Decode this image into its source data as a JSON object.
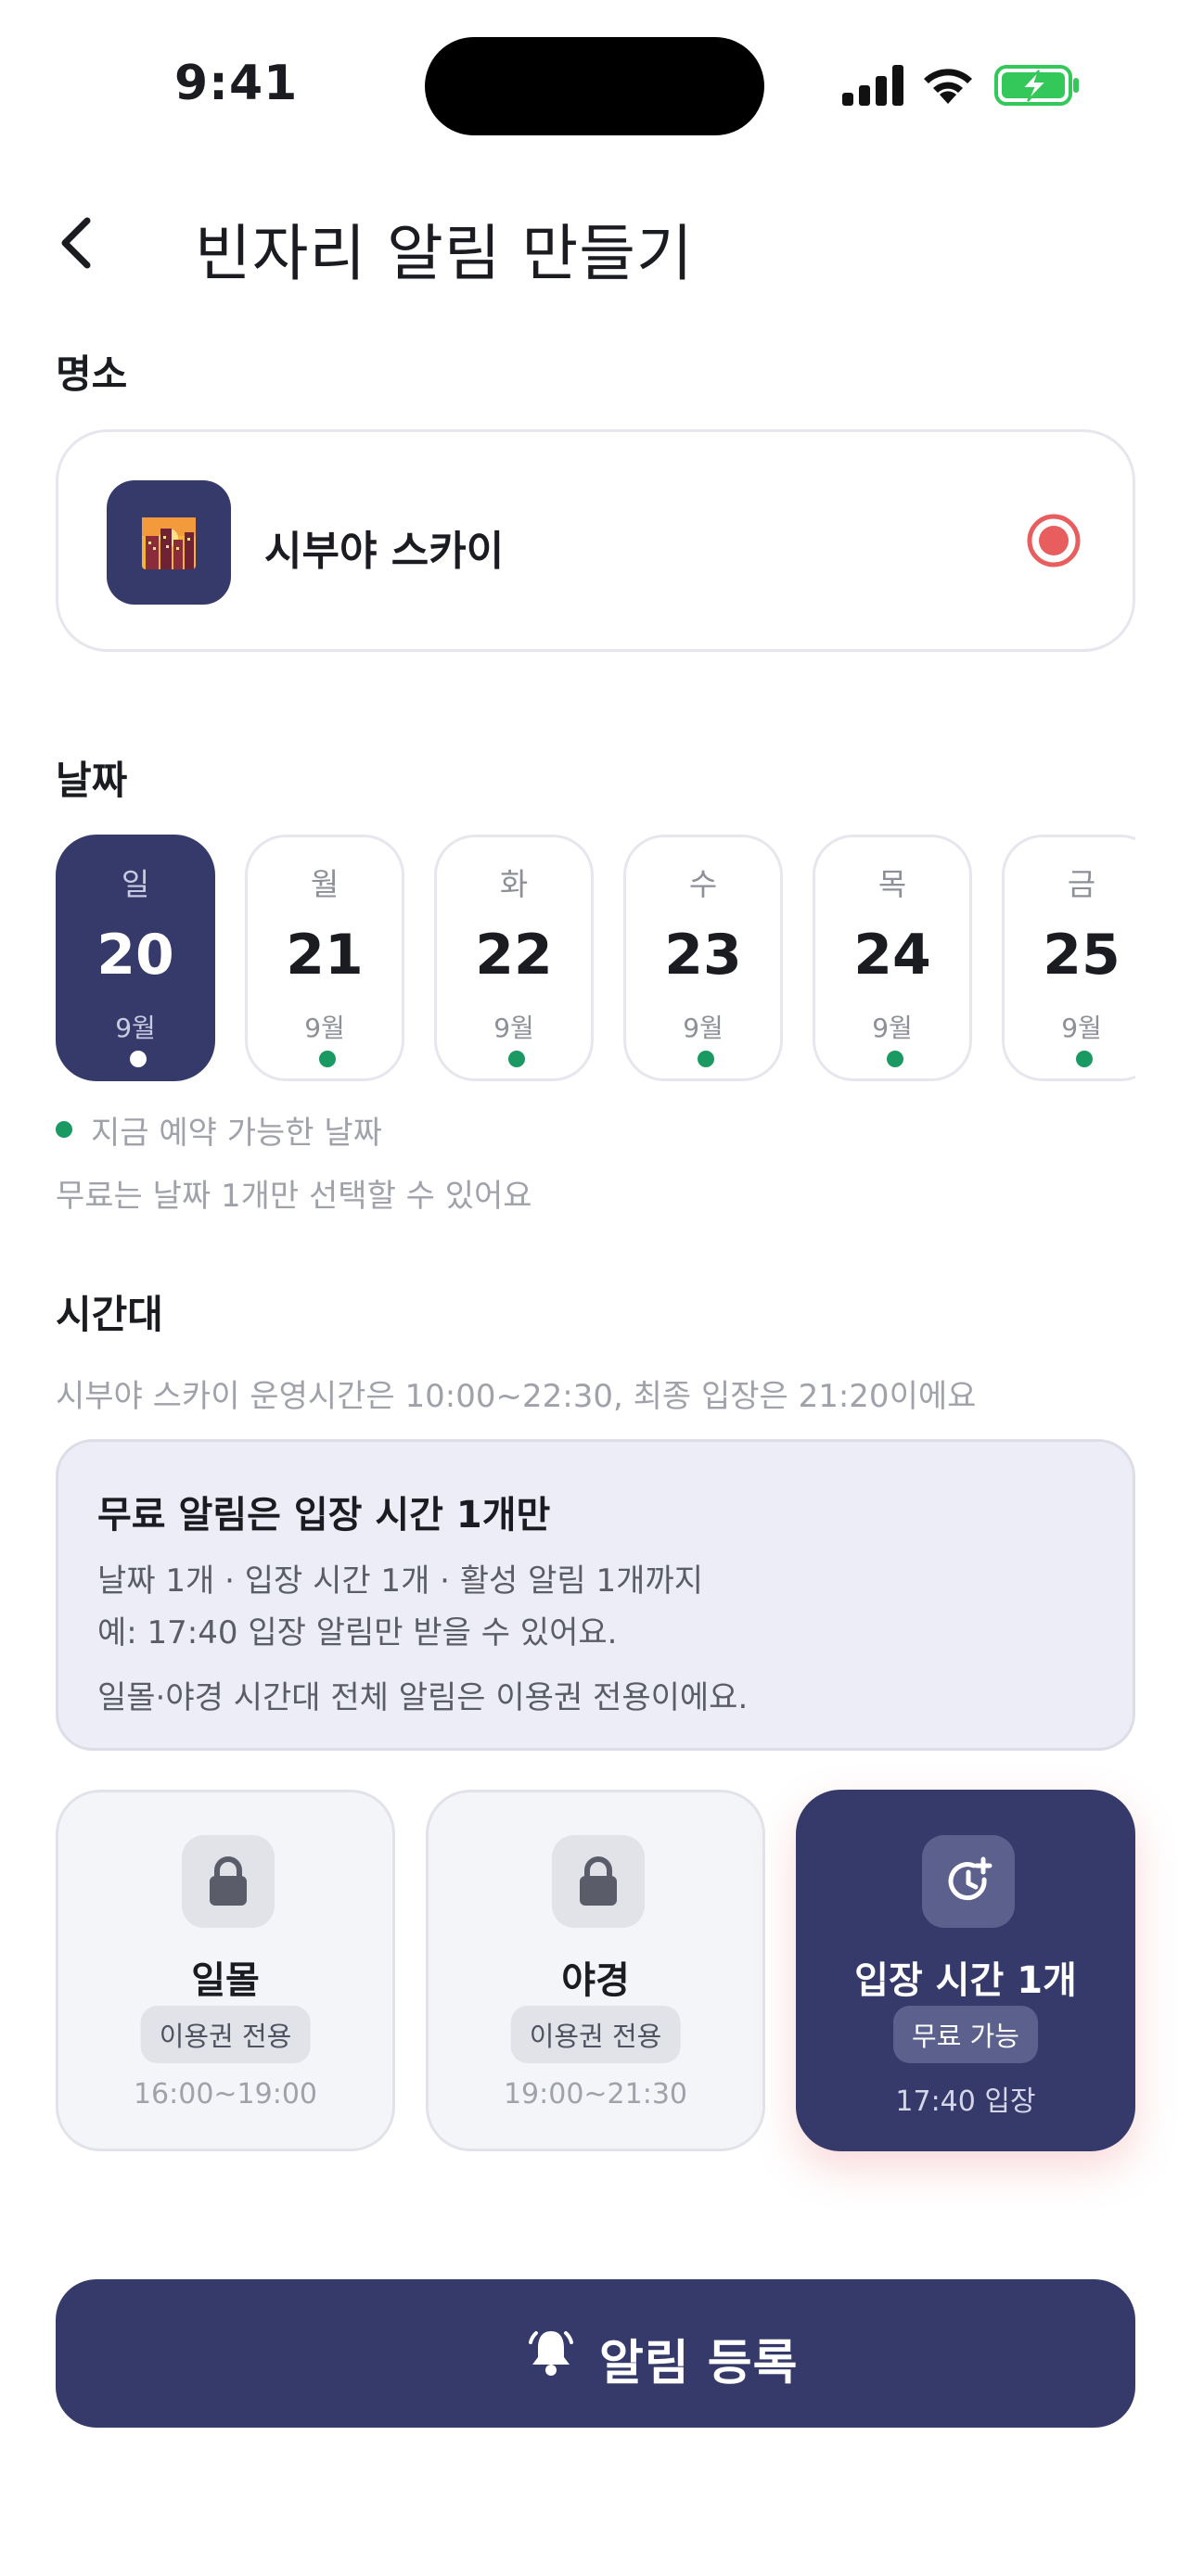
{
  "status_bar": {
    "time": "9:41"
  },
  "header": {
    "title": "빈자리 알림 만들기"
  },
  "sections": {
    "place": "명소",
    "date": "날짜",
    "time": "시간대"
  },
  "place": {
    "name": "시부야 스카이",
    "thumb_icon": "city-sunset-icon",
    "selected": true
  },
  "dates": [
    {
      "dow": "일",
      "day": "20",
      "month": "9월",
      "selected": true
    },
    {
      "dow": "월",
      "day": "21",
      "month": "9월",
      "selected": false
    },
    {
      "dow": "화",
      "day": "22",
      "month": "9월",
      "selected": false
    },
    {
      "dow": "수",
      "day": "23",
      "month": "9월",
      "selected": false
    },
    {
      "dow": "목",
      "day": "24",
      "month": "9월",
      "selected": false
    },
    {
      "dow": "금",
      "day": "25",
      "month": "9월",
      "selected": false
    }
  ],
  "date_legend": "지금 예약 가능한 날짜",
  "date_note": "무료는 날짜 1개만 선택할 수 있어요",
  "time_note": "시부야 스카이 운영시간은 10:00~22:30, 최종 입장은 21:20이에요",
  "info_box": {
    "title": "무료 알림은 입장 시간 1개만",
    "line1": "날짜 1개 · 입장 시간 1개 · 활성 알림 1개까지",
    "line2": "예: 17:40 입장 알림만 받을 수 있어요.",
    "line3": "일몰·야경 시간대 전체 알림은 이용권 전용이에요."
  },
  "slots": [
    {
      "name": "일몰",
      "badge": "이용권 전용",
      "range": "16:00~19:00",
      "icon": "lock-icon",
      "active": false
    },
    {
      "name": "야경",
      "badge": "이용권 전용",
      "range": "19:00~21:30",
      "icon": "lock-icon",
      "active": false
    },
    {
      "name": "입장 시간 1개",
      "badge": "무료 가능",
      "range": "17:40 입장",
      "icon": "clock-plus-icon",
      "active": true
    }
  ],
  "submit": {
    "label": "알림 등록",
    "icon": "bell-ring-icon"
  },
  "colors": {
    "primary": "#353a6b",
    "available_dot": "#1a9a62",
    "radio": "#e85d5d",
    "battery": "#34c759"
  }
}
